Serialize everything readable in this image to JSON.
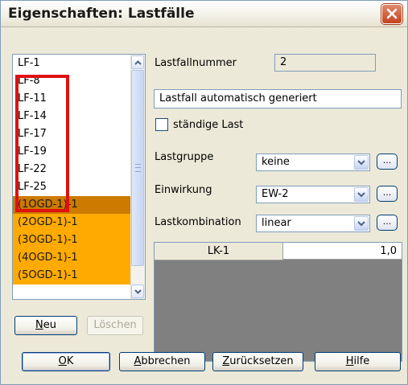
{
  "window": {
    "title": "Eigenschaften: Lastfälle"
  },
  "loadcase_list": {
    "items": [
      {
        "label": "LF-1"
      },
      {
        "label": "LF-8"
      },
      {
        "label": "LF-11"
      },
      {
        "label": "LF-14"
      },
      {
        "label": "LF-17"
      },
      {
        "label": "LF-19"
      },
      {
        "label": "LF-22"
      },
      {
        "label": "LF-25"
      },
      {
        "label": "(1OGD-1)-1",
        "highlight": "dark-orange"
      },
      {
        "label": "(2OGD-1)-1",
        "highlight": "orange"
      },
      {
        "label": "(3OGD-1)-1",
        "highlight": "orange"
      },
      {
        "label": "(4OGD-1)-1",
        "highlight": "orange"
      },
      {
        "label": "(5OGD-1)-1",
        "highlight": "orange"
      }
    ],
    "highlight_color": "#e01010",
    "generated_color": "#ffaa00"
  },
  "list_buttons": {
    "new": "Neu",
    "new_mnemonic": "N",
    "new_rest": "eu",
    "delete": "Löschen"
  },
  "properties": {
    "number_label": "Lastfallnummer",
    "number_value": "2",
    "description_value": "Lastfall automatisch generiert",
    "permanent_label": "ständige Last",
    "permanent_checked": false,
    "group_label": "Lastgruppe",
    "group_value": "keine",
    "action_label": "Einwirkung",
    "action_value": "EW-2",
    "combination_label": "Lastkombination",
    "combination_value": "linear",
    "dots_label": "..."
  },
  "combination_grid": {
    "rows": [
      {
        "name": "LK-1",
        "factor": "1,0"
      }
    ]
  },
  "footer": {
    "ok": {
      "mn": "O",
      "rest": "K"
    },
    "cancel": {
      "mn": "A",
      "rest": "bbrechen"
    },
    "reset": {
      "mn": "Z",
      "rest": "urücksetzen"
    },
    "help": {
      "mn": "H",
      "rest": "ilfe"
    }
  },
  "colors": {
    "accent": "#003c74",
    "window_bg": "#ece9d8",
    "close_red": "#c4441e"
  }
}
